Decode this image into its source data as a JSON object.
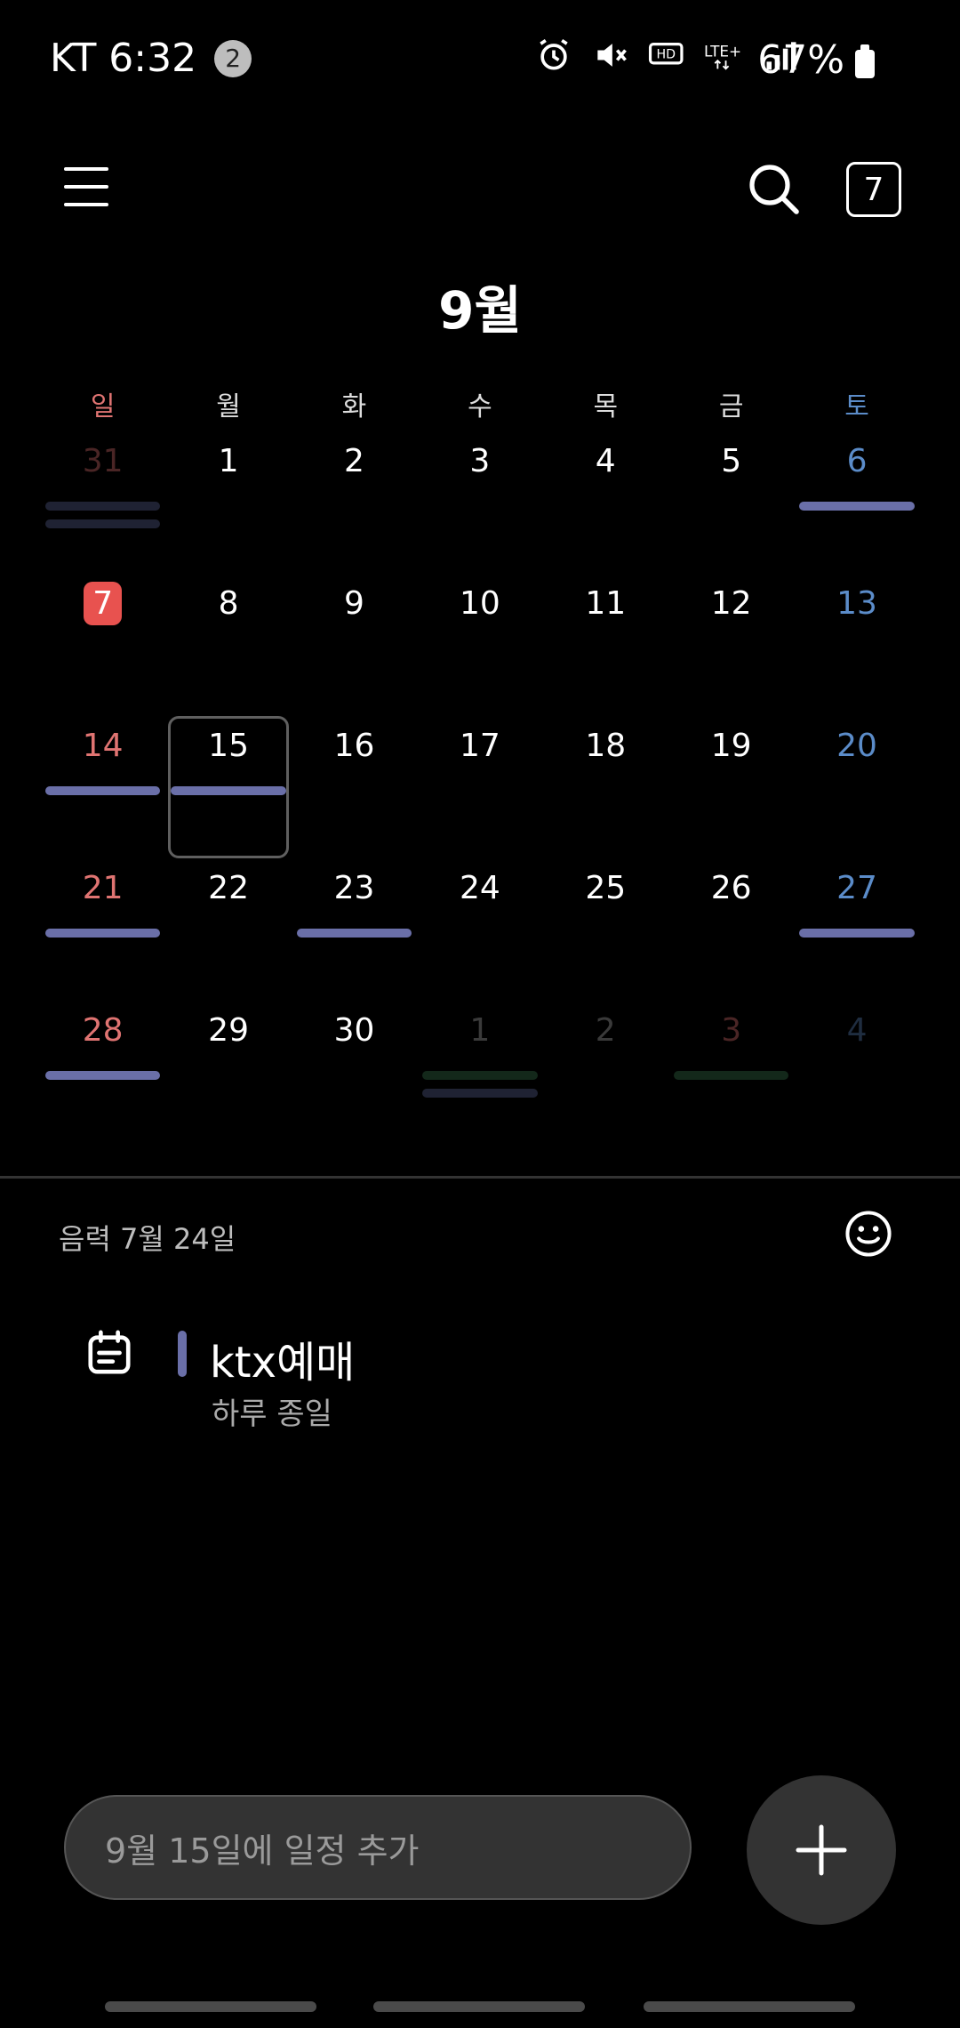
{
  "status": {
    "carrier_time": "KT 6:32",
    "notification_count": "2",
    "battery": "67%"
  },
  "header": {
    "today_number": "7",
    "month": "9월"
  },
  "weekdays": [
    "일",
    "월",
    "화",
    "수",
    "목",
    "금",
    "토"
  ],
  "calendar": {
    "weeks": [
      [
        "31",
        "1",
        "2",
        "3",
        "4",
        "5",
        "6"
      ],
      [
        "7",
        "8",
        "9",
        "10",
        "11",
        "12",
        "13"
      ],
      [
        "14",
        "15",
        "16",
        "17",
        "18",
        "19",
        "20"
      ],
      [
        "21",
        "22",
        "23",
        "24",
        "25",
        "26",
        "27"
      ],
      [
        "28",
        "29",
        "30",
        "1",
        "2",
        "3",
        "4"
      ]
    ]
  },
  "detail": {
    "lunar_date": "음력 7월 24일"
  },
  "event": {
    "title": "ktx예매",
    "time": "하루 종일",
    "color": "#6a6fa8"
  },
  "add_event": {
    "placeholder": "9월 15일에 일정 추가"
  },
  "colors": {
    "sunday": "#e07472",
    "saturday": "#5b8cc9",
    "today_bg": "#e8524f",
    "event_bar": "#6a6fa8"
  }
}
